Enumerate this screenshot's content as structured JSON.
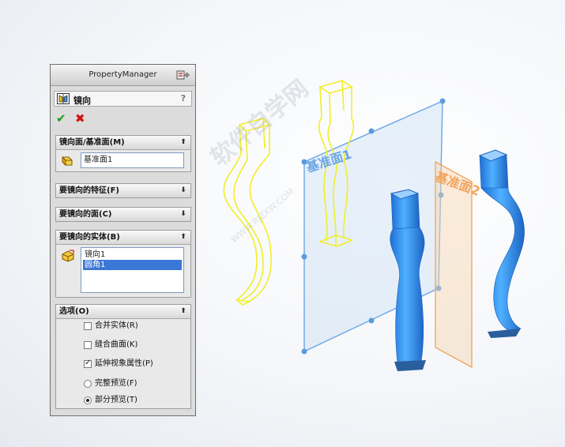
{
  "panel": {
    "title": "PropertyManager",
    "feature_name": "镜向",
    "help": "?",
    "ok": "✔",
    "cancel": "✖"
  },
  "groups": {
    "mirror_plane": {
      "header": "镜向面/基准面(M)",
      "value": "基准面1"
    },
    "features": {
      "header": "要镜向的特征(F)"
    },
    "faces": {
      "header": "要镜向的面(C)"
    },
    "bodies": {
      "header": "要镜向的实体(B)",
      "items": [
        "镜向1",
        "圆角1"
      ],
      "selected_index": 1
    },
    "options": {
      "header": "选项(O)",
      "merge_solids": {
        "label": "合并实体(R)",
        "checked": false
      },
      "knit_surfaces": {
        "label": "缝合曲面(K)",
        "checked": false
      },
      "propagate_visual": {
        "label": "延伸视象属性(P)",
        "checked": true
      },
      "full_preview": {
        "label": "完整预览(F)",
        "selected": false
      },
      "partial_preview": {
        "label": "部分预览(T)",
        "selected": true
      }
    }
  },
  "viewport": {
    "plane1_label": "基准面1",
    "plane2_label": "基准面2",
    "watermark": "软件自学网",
    "watermark_url": "WWW.RJZXW.COM"
  },
  "colors": {
    "preview_yellow": "#f2ee2a",
    "body_blue": "#2f8ff0",
    "plane1_blue": "#6aa6e6",
    "plane2_orange": "#f2a35a"
  }
}
